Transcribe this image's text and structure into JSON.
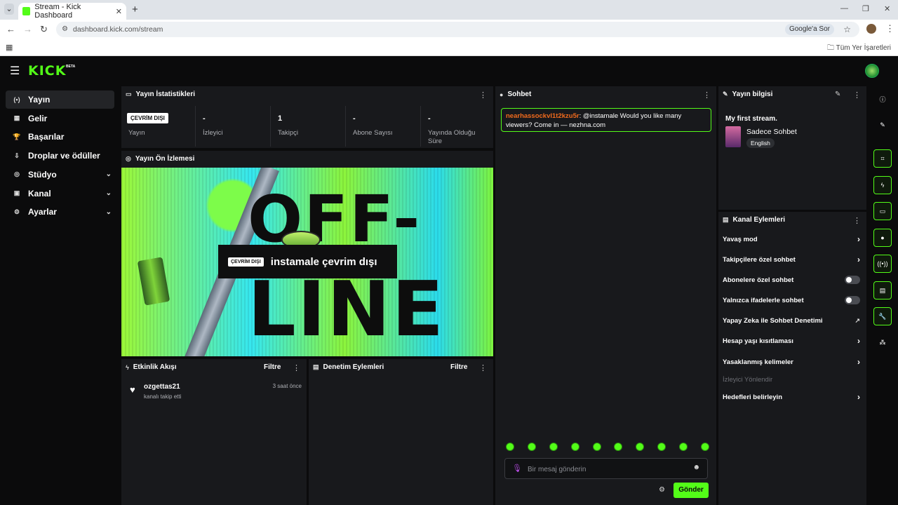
{
  "browser": {
    "tab_title": "Stream - Kick Dashboard",
    "tab_close": "✕",
    "new_tab": "+",
    "url": "dashboard.kick.com/stream",
    "google_ask": "Google'a Sor",
    "all_bookmarks": "Tüm Yer İşaretleri"
  },
  "app": {
    "logo": "KICK",
    "logo_badge": "BETA"
  },
  "sidebar": {
    "items": [
      {
        "label": "Yayın",
        "icon": "broadcast-icon",
        "glyph": "(•)",
        "active": true,
        "chevron": false
      },
      {
        "label": "Gelir",
        "icon": "revenue-icon",
        "glyph": "▦",
        "active": false,
        "chevron": false
      },
      {
        "label": "Başarılar",
        "icon": "trophy-icon",
        "glyph": "🏆",
        "active": false,
        "chevron": false
      },
      {
        "label": "Droplar ve ödüller",
        "icon": "drops-icon",
        "glyph": "⇩",
        "active": false,
        "chevron": false
      },
      {
        "label": "Stüdyo",
        "icon": "studio-icon",
        "glyph": "◎",
        "active": false,
        "chevron": true
      },
      {
        "label": "Kanal",
        "icon": "channel-icon",
        "glyph": "▣",
        "active": false,
        "chevron": true
      },
      {
        "label": "Ayarlar",
        "icon": "settings-icon",
        "glyph": "⚙",
        "active": false,
        "chevron": true
      }
    ]
  },
  "stats": {
    "title": "Yayın İstatistikleri",
    "status_badge": "ÇEVRİM DIŞI",
    "status_label": "Yayın",
    "items": [
      {
        "value": "-",
        "label": "İzleyici"
      },
      {
        "value": "1",
        "label": "Takipçi"
      },
      {
        "value": "-",
        "label": "Abone Sayısı"
      },
      {
        "value": "-",
        "label": "Yayında Olduğu Süre"
      }
    ]
  },
  "preview": {
    "title": "Yayın Ön İzlemesi",
    "offline_word_top": "OFF-",
    "offline_word_bottom": "LINE",
    "badge": "ÇEVRİM DIŞI",
    "overlay_text": "instamale çevrim dışı"
  },
  "activity": {
    "title": "Etkinlik Akışı",
    "filter": "Filtre",
    "items": [
      {
        "user": "ozgettas21",
        "action": "kanalı takip etti",
        "time": "3 saat önce"
      }
    ]
  },
  "moderation": {
    "title": "Denetim Eylemleri",
    "filter": "Filtre"
  },
  "chat": {
    "title": "Sohbet",
    "message_user": "nearhassockvl1t2kzu5r",
    "message_text": ": @instamale Would you like many viewers? Come in — nezhna.com",
    "emote_count": 10,
    "placeholder": "Bir mesaj gönderin",
    "send": "Gönder"
  },
  "stream_info": {
    "title": "Yayın bilgisi",
    "stream_name": "My first stream.",
    "category": "Sadece Sohbet",
    "language": "English"
  },
  "channel_actions": {
    "title": "Kanal Eylemleri",
    "items": [
      {
        "label": "Yavaş mod",
        "control": "arrow"
      },
      {
        "label": "Takipçilere özel sohbet",
        "control": "arrow"
      },
      {
        "label": "Abonelere özel sohbet",
        "control": "toggle",
        "enabled": false
      },
      {
        "label": "Yalnızca ifadelerle sohbet",
        "control": "toggle",
        "enabled": false
      },
      {
        "label": "Yapay Zeka ile Sohbet Denetimi",
        "control": "external"
      },
      {
        "label": "Hesap yaşı kısıtlaması",
        "control": "arrow"
      },
      {
        "label": "Yasaklanmış kelimeler",
        "control": "arrow"
      },
      {
        "label": "İzleyici Yönlendir",
        "control": "none",
        "disabled": true
      },
      {
        "label": "Hedefleri belirleyin",
        "control": "arrow"
      }
    ]
  },
  "rail": {
    "items": [
      "info-icon",
      "pencil-icon",
      "clip-icon",
      "lightning-icon",
      "card-icon",
      "chat-icon",
      "broadcast-icon",
      "mod-icon",
      "wrench-icon",
      "share-icon"
    ]
  }
}
